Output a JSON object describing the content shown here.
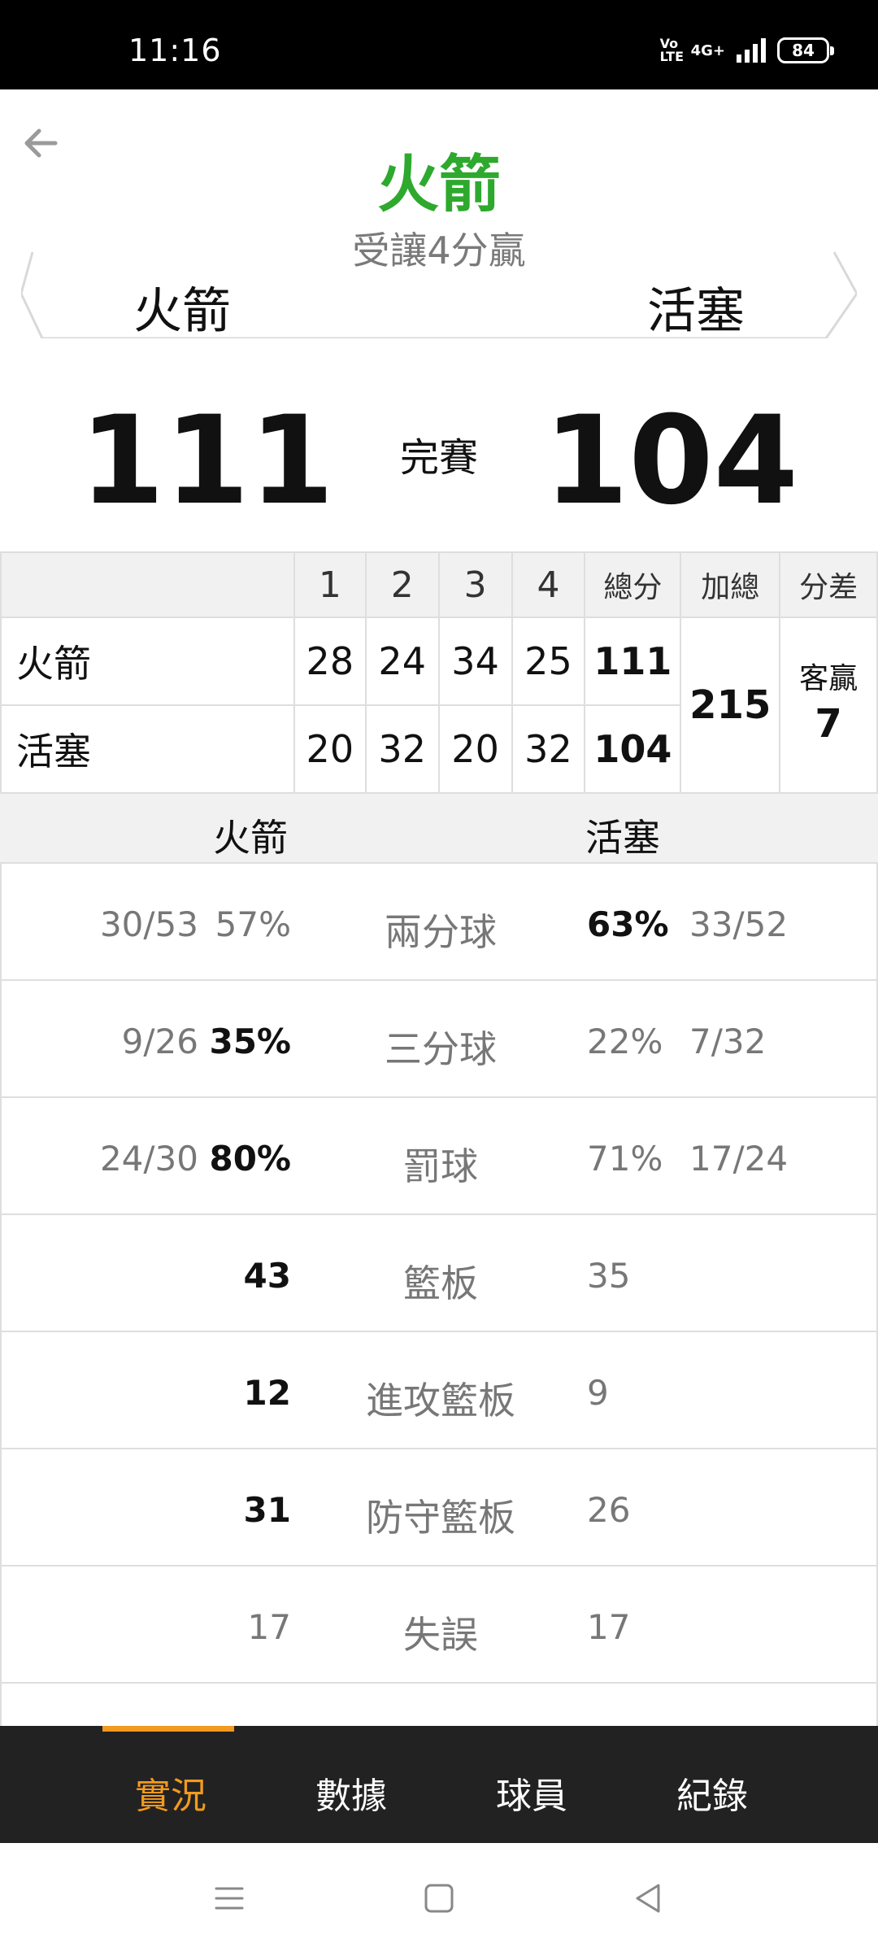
{
  "status_bar": {
    "time": "11:16",
    "volte": "Vo LTE",
    "network": "4G+",
    "battery": "84"
  },
  "header": {
    "title": "火箭",
    "subtitle": "受讓4分贏",
    "team_left": "火箭",
    "team_right": "活塞"
  },
  "score": {
    "left": "111",
    "status": "完賽",
    "right": "104"
  },
  "quarter_table": {
    "headers": [
      "1",
      "2",
      "3",
      "4",
      "總分",
      "加總",
      "分差"
    ],
    "rows": [
      {
        "team": "火箭",
        "q": [
          "28",
          "24",
          "34",
          "25"
        ],
        "total": "111"
      },
      {
        "team": "活塞",
        "q": [
          "20",
          "32",
          "20",
          "32"
        ],
        "total": "104"
      }
    ],
    "combined": "215",
    "diff_label": "客贏",
    "diff_value": "7"
  },
  "stats": {
    "left_team": "火箭",
    "right_team": "活塞",
    "rows": [
      {
        "name": "兩分球",
        "left_frac": "30/53",
        "left_val": "57%",
        "right_val": "63%",
        "right_frac": "33/52"
      },
      {
        "name": "三分球",
        "left_frac": "9/26",
        "left_val": "35%",
        "right_val": "22%",
        "right_frac": "7/32"
      },
      {
        "name": "罰球",
        "left_frac": "24/30",
        "left_val": "80%",
        "right_val": "71%",
        "right_frac": "17/24"
      },
      {
        "name": "籃板",
        "left_frac": "",
        "left_val": "43",
        "right_val": "35",
        "right_frac": ""
      },
      {
        "name": "進攻籃板",
        "left_frac": "",
        "left_val": "12",
        "right_val": "9",
        "right_frac": ""
      },
      {
        "name": "防守籃板",
        "left_frac": "",
        "left_val": "31",
        "right_val": "26",
        "right_frac": ""
      },
      {
        "name": "失誤",
        "left_frac": "",
        "left_val": "17",
        "right_val": "17",
        "right_frac": ""
      }
    ]
  },
  "tabs": [
    "實況",
    "數據",
    "球員",
    "紀錄"
  ],
  "colors": {
    "accent": "#f29a1f",
    "title_green": "#2ea92e",
    "tabbar_bg": "#222222"
  }
}
